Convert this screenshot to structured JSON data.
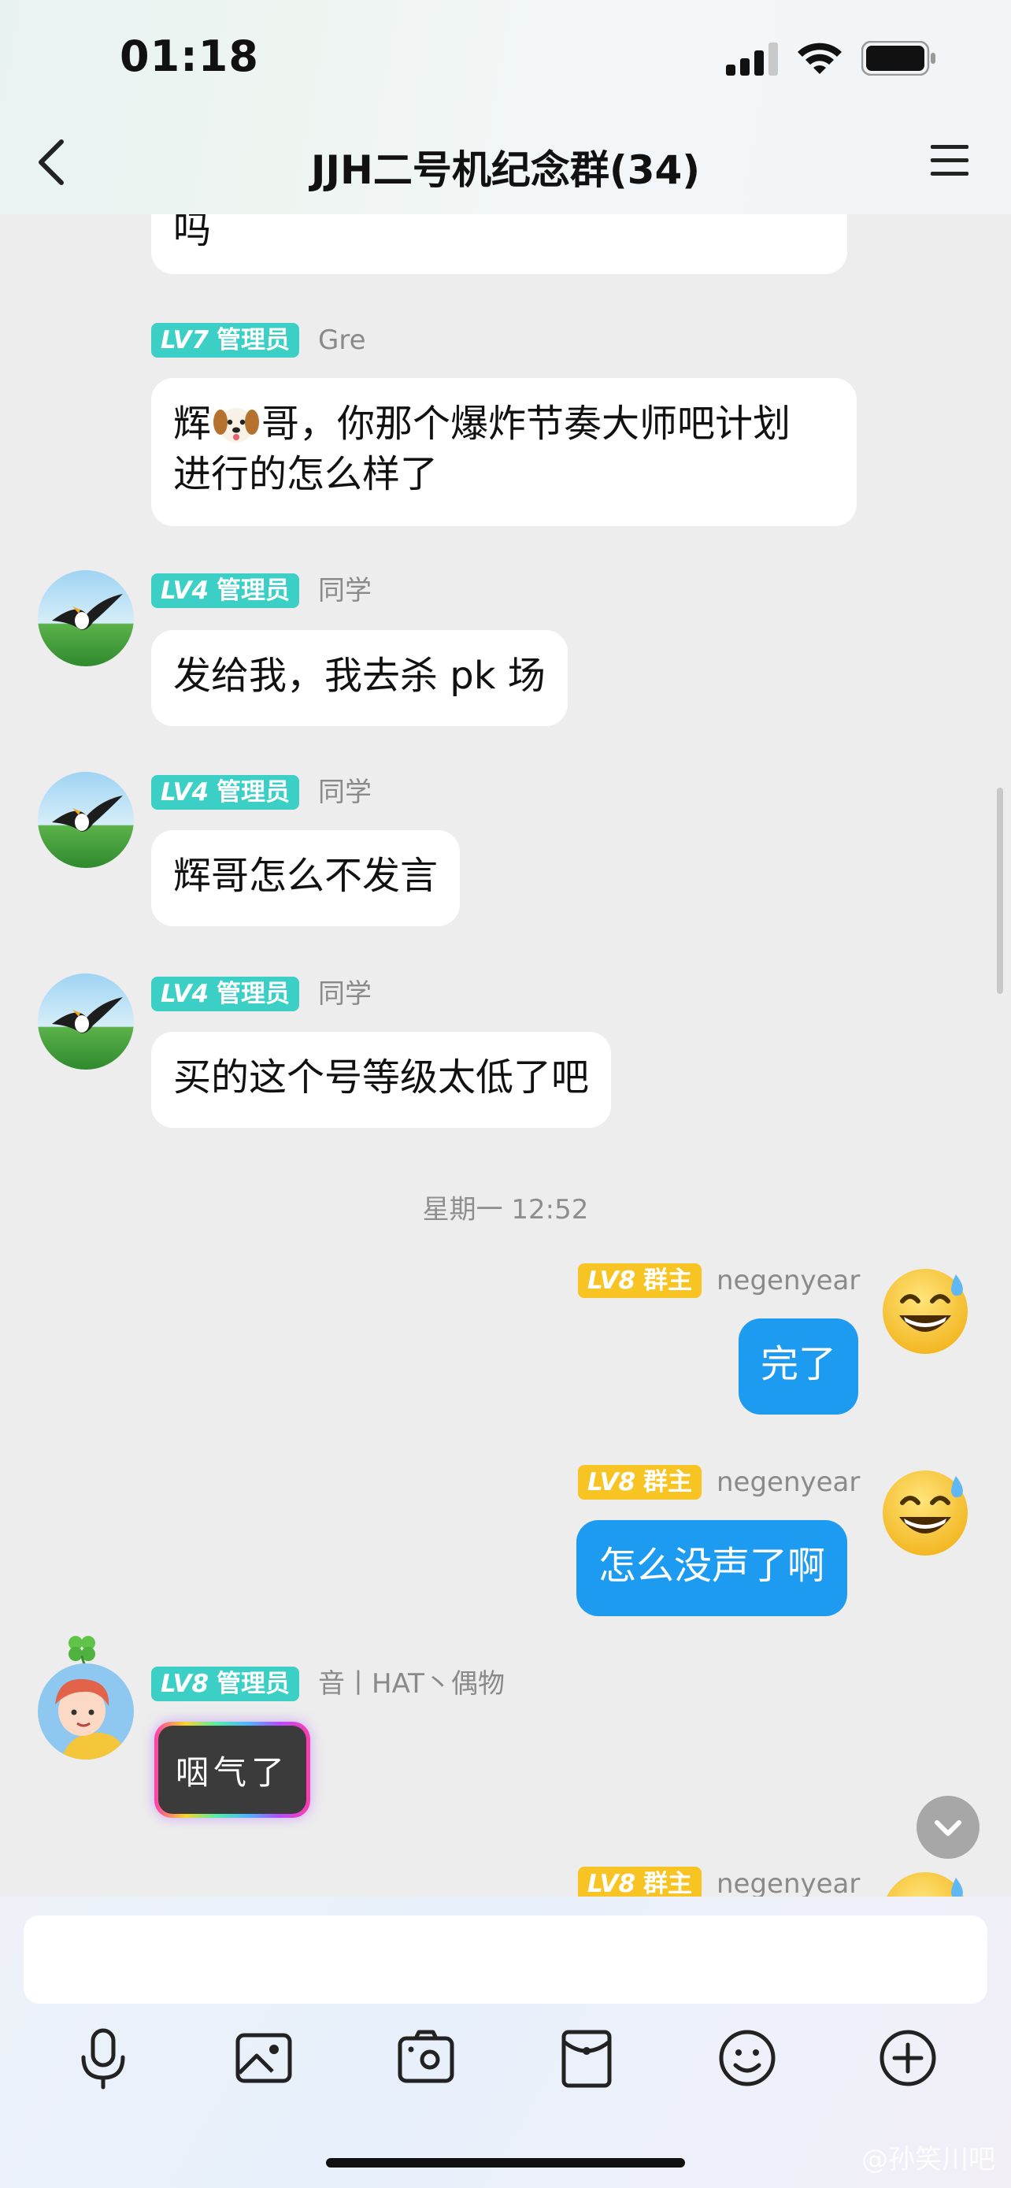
{
  "status_bar": {
    "time": "01:18"
  },
  "header": {
    "title": "JJH二号机纪念群(34)",
    "back_icon": "chevron-left-icon",
    "menu_icon": "hamburger-menu-icon"
  },
  "messages": [
    {
      "text": "吗"
    },
    {
      "level": "LV7",
      "role": "管理员",
      "nick": "Gre",
      "text_before": "辉",
      "emoji": "dog-face",
      "text_after": "哥，你那个爆炸节奏大师吧计划",
      "line2": "进行的怎么样了"
    },
    {
      "level": "LV4",
      "role": "管理员",
      "nick": "同学",
      "text": "发给我，我去杀 pk 场"
    },
    {
      "level": "LV4",
      "role": "管理员",
      "nick": "同学",
      "text": "辉哥怎么不发言"
    },
    {
      "level": "LV4",
      "role": "管理员",
      "nick": "同学",
      "text": "买的这个号等级太低了吧"
    },
    {
      "timestamp": "星期一 12:52"
    },
    {
      "level": "LV8",
      "role": "群主",
      "nick": "negenyear",
      "text": "完了"
    },
    {
      "level": "LV8",
      "role": "群主",
      "nick": "negenyear",
      "text": "怎么没声了啊"
    },
    {
      "level": "LV8",
      "role": "管理员",
      "nick": "音丨HAT丶偶物",
      "text": "咽气了"
    },
    {
      "level": "LV8",
      "role": "群主",
      "nick": "negenyear"
    }
  ],
  "toolbar": {
    "icons": [
      "microphone-icon",
      "image-icon",
      "camera-icon",
      "red-packet-icon",
      "emoji-icon",
      "plus-icon"
    ]
  },
  "watermark": "@孙笑川吧",
  "colors": {
    "admin_tag": "#3ccfc6",
    "owner_tag": "#f8c423",
    "my_bubble": "#1d9bf0",
    "background": "#ededed"
  }
}
